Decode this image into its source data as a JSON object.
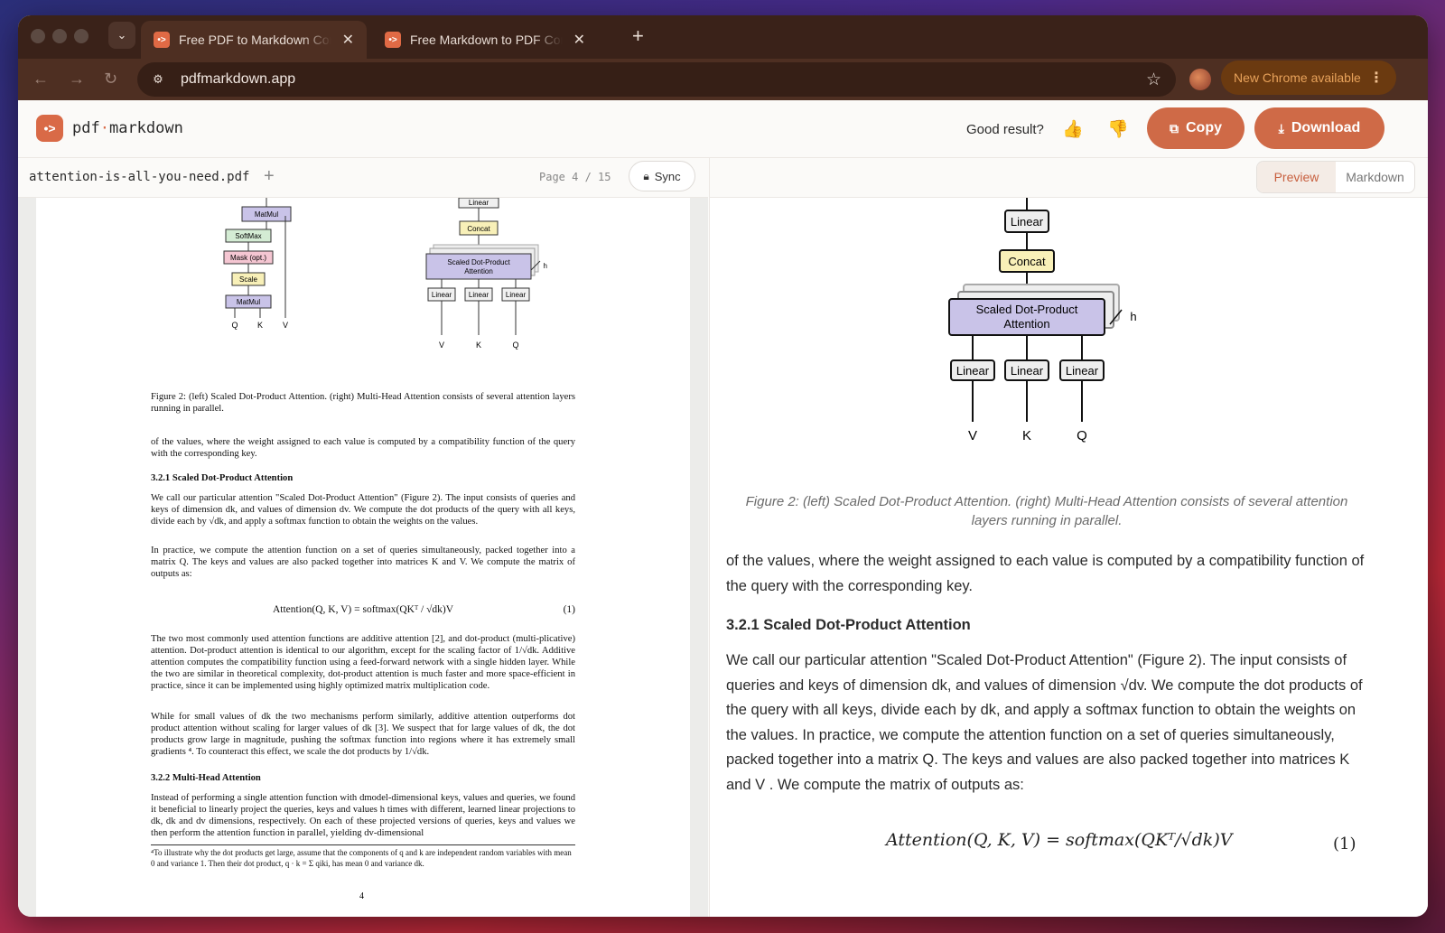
{
  "browser": {
    "tabs": [
      {
        "title": "Free PDF to Markdown Converter",
        "favicon": "•>"
      },
      {
        "title": "Free Markdown to PDF Converter",
        "favicon": "•>"
      }
    ],
    "url": "pdfmarkdown.app",
    "update_label": "New Chrome available"
  },
  "app": {
    "logo_mark": "•>",
    "logo_text_a": "pdf",
    "logo_dot": "·",
    "logo_text_b": "markdown",
    "feedback_label": "Good result?",
    "thumbs_up": "👍",
    "thumbs_down": "👎",
    "copy_label": "Copy",
    "download_label": "Download"
  },
  "left": {
    "filename": "attention-is-all-you-need.pdf",
    "page_indicator": "Page 4 / 15",
    "sync_label": "Sync"
  },
  "right": {
    "toggle": [
      "Preview",
      "Markdown"
    ],
    "active_view": "Preview"
  },
  "pdf": {
    "left_diagram": {
      "boxes": [
        "MatMul",
        "SoftMax",
        "Mask (opt.)",
        "Scale",
        "MatMul"
      ],
      "inputs": [
        "Q",
        "K",
        "V"
      ]
    },
    "right_diagram": {
      "top": "Linear",
      "concat": "Concat",
      "attn_line1": "Scaled Dot-Product",
      "attn_line2": "Attention",
      "h": "h",
      "linears": [
        "Linear",
        "Linear",
        "Linear"
      ],
      "inputs": [
        "V",
        "K",
        "Q"
      ]
    },
    "caption": "Figure 2: (left) Scaled Dot-Product Attention. (right) Multi-Head Attention consists of several attention layers running in parallel.",
    "p1": "of the values, where the weight assigned to each value is computed by a compatibility function of the query with the corresponding key.",
    "h1": "3.2.1   Scaled Dot-Product Attention",
    "p2": "We call our particular attention \"Scaled Dot-Product Attention\" (Figure 2). The input consists of queries and keys of dimension dk, and values of dimension dv. We compute the dot products of the query with all keys, divide each by √dk, and apply a softmax function to obtain the weights on the values.",
    "p3": "In practice, we compute the attention function on a set of queries simultaneously, packed together into a matrix Q. The keys and values are also packed together into matrices K and V. We compute the matrix of outputs as:",
    "eq": "Attention(Q, K, V) = softmax(QKᵀ / √dk)V",
    "eq_num": "(1)",
    "p4": "The two most commonly used attention functions are additive attention [2], and dot-product (multi-plicative) attention. Dot-product attention is identical to our algorithm, except for the scaling factor of 1/√dk. Additive attention computes the compatibility function using a feed-forward network with a single hidden layer. While the two are similar in theoretical complexity, dot-product attention is much faster and more space-efficient in practice, since it can be implemented using highly optimized matrix multiplication code.",
    "p5": "While for small values of dk the two mechanisms perform similarly, additive attention outperforms dot product attention without scaling for larger values of dk [3]. We suspect that for large values of dk, the dot products grow large in magnitude, pushing the softmax function into regions where it has extremely small gradients ⁴. To counteract this effect, we scale the dot products by 1/√dk.",
    "h2": "3.2.2   Multi-Head Attention",
    "p6": "Instead of performing a single attention function with dmodel-dimensional keys, values and queries, we found it beneficial to linearly project the queries, keys and values h times with different, learned linear projections to dk, dk and dv dimensions, respectively. On each of these projected versions of queries, keys and values we then perform the attention function in parallel, yielding dv-dimensional",
    "footnote": "⁴To illustrate why the dot products get large, assume that the components of q and k are independent random variables with mean 0 and variance 1. Then their dot product, q · k = Σ qiki, has mean 0 and variance dk.",
    "page_number": "4"
  },
  "preview": {
    "diagram": {
      "top": "Linear",
      "concat": "Concat",
      "attn_line1": "Scaled Dot-Product",
      "attn_line2": "Attention",
      "h": "h",
      "linears": [
        "Linear",
        "Linear",
        "Linear"
      ],
      "inputs": [
        "V",
        "K",
        "Q"
      ]
    },
    "caption": "Figure 2: (left) Scaled Dot-Product Attention. (right) Multi-Head Attention consists of several attention layers running in parallel.",
    "p1": "of the values, where the weight assigned to each value is computed by a compatibility function of the query with the corresponding key.",
    "heading": "3.2.1 Scaled Dot-Product Attention",
    "p2": "We call our particular attention \"Scaled Dot-Product Attention\" (Figure 2). The input consists of queries and keys of dimension dk, and values of dimension √dv. We compute the dot products of the query with all keys, divide each by dk, and apply a softmax function to obtain the weights on the values. In practice, we compute the attention function on a set of queries simultaneously, packed together into a matrix Q. The keys and values are also packed together into matrices K and V . We compute the matrix of outputs as:",
    "eq": "Attention(Q, K, V) = softmax(QKᵀ/√dk)V",
    "eq_num": "(1)"
  }
}
